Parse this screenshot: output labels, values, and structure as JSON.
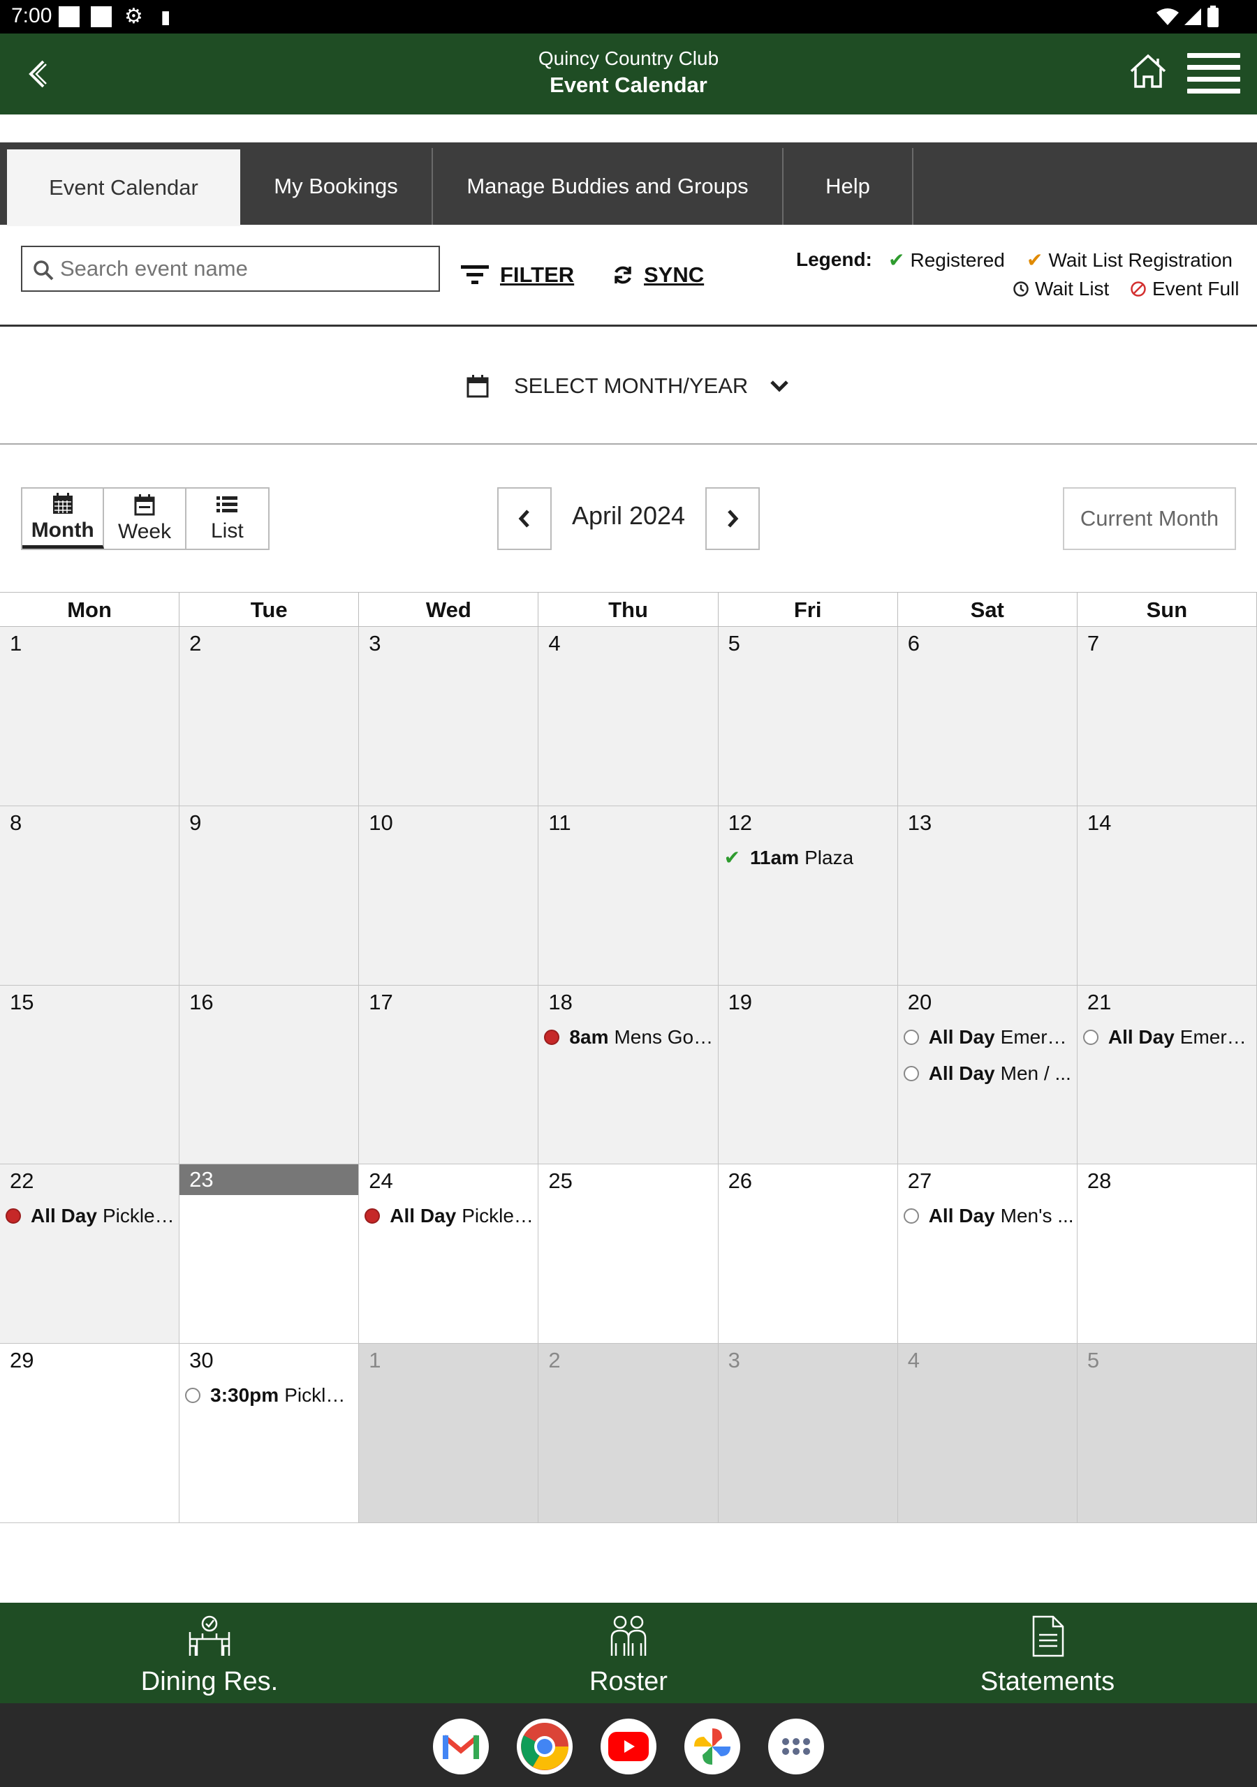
{
  "status_bar": {
    "time": "7:00"
  },
  "header": {
    "club_name": "Quincy Country Club",
    "title": "Event Calendar"
  },
  "tabs": [
    {
      "label": "Event Calendar",
      "active": true
    },
    {
      "label": "My Bookings",
      "active": false
    },
    {
      "label": "Manage Buddies and Groups",
      "active": false
    },
    {
      "label": "Help",
      "active": false
    }
  ],
  "search": {
    "placeholder": "Search event name",
    "value": ""
  },
  "toolbar": {
    "filter_label": "FILTER",
    "sync_label": "SYNC"
  },
  "legend": {
    "title": "Legend:",
    "registered": "Registered",
    "wait_list_registration": "Wait List Registration",
    "wait_list": "Wait List",
    "event_full": "Event Full",
    "colors": {
      "registered": "#2e9b2e",
      "wait_list_registration": "#e08a00",
      "wait_list": "#222222",
      "event_full": "#d32f2f"
    }
  },
  "month_select": {
    "label": "SELECT MONTH/YEAR"
  },
  "view_switch": {
    "month": "Month",
    "week": "Week",
    "list": "List",
    "active": "Month"
  },
  "month_nav": {
    "label": "April 2024",
    "current_month": "Current Month"
  },
  "calendar": {
    "days_of_week": [
      "Mon",
      "Tue",
      "Wed",
      "Thu",
      "Fri",
      "Sat",
      "Sun"
    ],
    "weeks": [
      [
        {
          "day": "1",
          "state": "past",
          "events": []
        },
        {
          "day": "2",
          "state": "past",
          "events": []
        },
        {
          "day": "3",
          "state": "past",
          "events": []
        },
        {
          "day": "4",
          "state": "past",
          "events": []
        },
        {
          "day": "5",
          "state": "past",
          "events": []
        },
        {
          "day": "6",
          "state": "past",
          "events": []
        },
        {
          "day": "7",
          "state": "past",
          "events": []
        }
      ],
      [
        {
          "day": "8",
          "state": "past",
          "events": []
        },
        {
          "day": "9",
          "state": "past",
          "events": []
        },
        {
          "day": "10",
          "state": "past",
          "events": []
        },
        {
          "day": "11",
          "state": "past",
          "events": []
        },
        {
          "day": "12",
          "state": "past",
          "events": [
            {
              "status": "registered",
              "time": "11am",
              "name": "Plaza"
            }
          ]
        },
        {
          "day": "13",
          "state": "past",
          "events": []
        },
        {
          "day": "14",
          "state": "past",
          "events": []
        }
      ],
      [
        {
          "day": "15",
          "state": "past",
          "events": []
        },
        {
          "day": "16",
          "state": "past",
          "events": []
        },
        {
          "day": "17",
          "state": "past",
          "events": []
        },
        {
          "day": "18",
          "state": "past",
          "events": [
            {
              "status": "full",
              "time": "8am",
              "name": "Mens Golf..."
            }
          ]
        },
        {
          "day": "19",
          "state": "past",
          "events": []
        },
        {
          "day": "20",
          "state": "past",
          "events": [
            {
              "status": "open",
              "time": "All Day",
              "name": "Emery ..."
            },
            {
              "status": "open",
              "time": "All Day",
              "name": "Men / ..."
            }
          ]
        },
        {
          "day": "21",
          "state": "past",
          "events": [
            {
              "status": "open",
              "time": "All Day",
              "name": "Emery ..."
            }
          ]
        }
      ],
      [
        {
          "day": "22",
          "state": "past",
          "events": [
            {
              "status": "full",
              "time": "All Day",
              "name": "Pickleb..."
            }
          ]
        },
        {
          "day": "23",
          "state": "today",
          "events": []
        },
        {
          "day": "24",
          "state": "future",
          "events": [
            {
              "status": "full",
              "time": "All Day",
              "name": "Pickleb..."
            }
          ]
        },
        {
          "day": "25",
          "state": "future",
          "events": []
        },
        {
          "day": "26",
          "state": "future",
          "events": []
        },
        {
          "day": "27",
          "state": "future",
          "events": [
            {
              "status": "open",
              "time": "All Day",
              "name": "Men's ..."
            }
          ]
        },
        {
          "day": "28",
          "state": "future",
          "events": []
        }
      ],
      [
        {
          "day": "29",
          "state": "future",
          "events": []
        },
        {
          "day": "30",
          "state": "future",
          "events": [
            {
              "status": "open",
              "time": "3:30pm",
              "name": "Pickleb..."
            }
          ]
        },
        {
          "day": "1",
          "state": "other",
          "events": []
        },
        {
          "day": "2",
          "state": "other",
          "events": []
        },
        {
          "day": "3",
          "state": "other",
          "events": []
        },
        {
          "day": "4",
          "state": "other",
          "events": []
        },
        {
          "day": "5",
          "state": "other",
          "events": []
        }
      ]
    ]
  },
  "bottom_nav": [
    {
      "label": "Dining Res.",
      "icon": "dining-icon"
    },
    {
      "label": "Roster",
      "icon": "roster-icon"
    },
    {
      "label": "Statements",
      "icon": "statements-icon"
    }
  ],
  "dock_apps": [
    "gmail-icon",
    "chrome-icon",
    "youtube-icon",
    "photos-icon",
    "app-drawer-icon"
  ]
}
